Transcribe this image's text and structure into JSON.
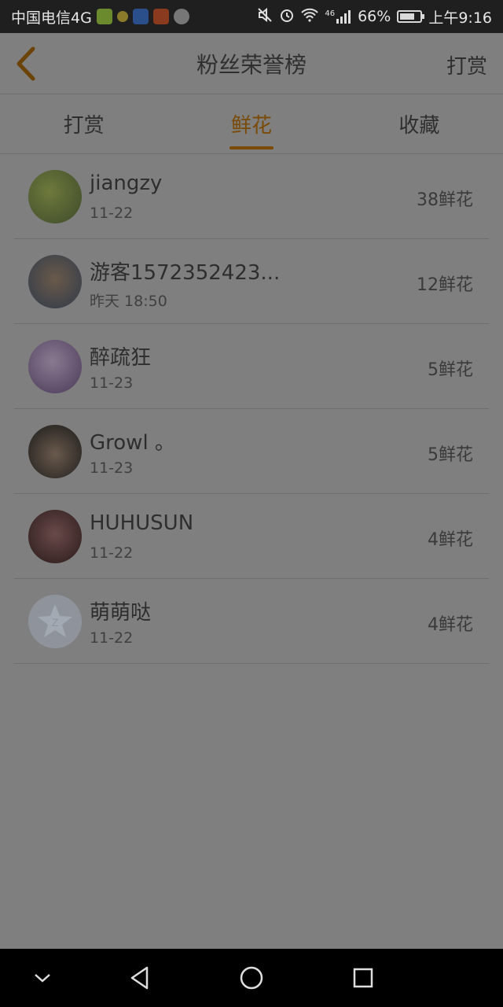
{
  "status": {
    "carrier": "中国电信4G",
    "signal": "46",
    "battery": "66%",
    "time": "上午9:16"
  },
  "header": {
    "title": "粉丝荣誉榜",
    "reward_label": "打赏"
  },
  "tabs": [
    {
      "label": "打赏",
      "active": false
    },
    {
      "label": "鲜花",
      "active": true
    },
    {
      "label": "收藏",
      "active": false
    }
  ],
  "fans": [
    {
      "name": "jiangzy",
      "date": "11-22",
      "count": "38鲜花"
    },
    {
      "name": "游客1572352423...",
      "date": "昨天 18:50",
      "count": "12鲜花"
    },
    {
      "name": "醉疏狂",
      "date": "11-23",
      "count": "5鲜花"
    },
    {
      "name": "Growl 。",
      "date": "11-23",
      "count": "5鲜花"
    },
    {
      "name": "HUHUSUN",
      "date": "11-22",
      "count": "4鲜花"
    },
    {
      "name": "萌萌哒",
      "date": "11-22",
      "count": "4鲜花"
    }
  ],
  "colors": {
    "accent": "#7a4a06",
    "overlay_bg": "#7f7f7f"
  }
}
